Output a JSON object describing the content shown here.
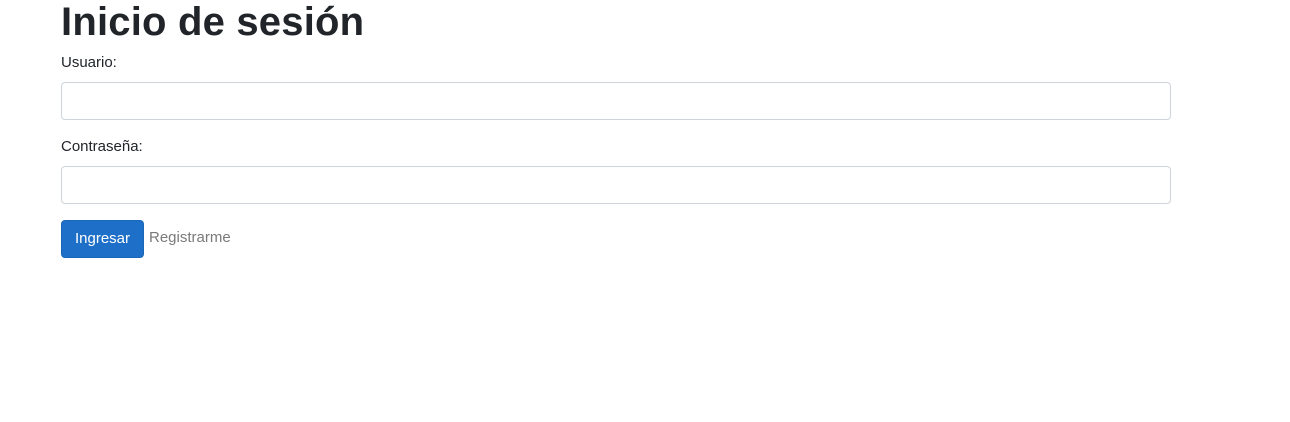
{
  "login": {
    "title": "Inicio de sesión",
    "username_label": "Usuario:",
    "username_value": "",
    "password_label": "Contraseña:",
    "password_value": "",
    "submit_label": "Ingresar",
    "register_link": "Registrarme"
  },
  "colors": {
    "primary": "#1e6fc7",
    "link": "#7a7a7a",
    "input_border": "#ced4da"
  }
}
